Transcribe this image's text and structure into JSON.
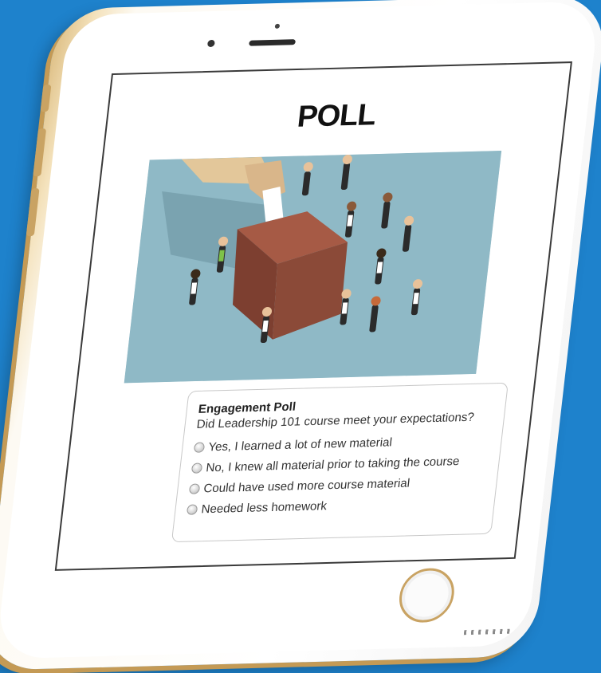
{
  "colors": {
    "background": "#1e82cc",
    "phone_gold": "#c9a363",
    "illustration_bg": "#8fb9c6",
    "ballot_box": "#8b4a38"
  },
  "screen": {
    "title": "POLL",
    "illustration_icon": "ballot-box-voting-illustration"
  },
  "poll": {
    "heading": "Engagement Poll",
    "question": "Did Leadership 101 course meet your expectations?",
    "options": [
      "Yes, I learned a lot of new material",
      "No, I knew all material prior to taking the course",
      "Could have used more course material",
      "Needed less homework"
    ]
  }
}
